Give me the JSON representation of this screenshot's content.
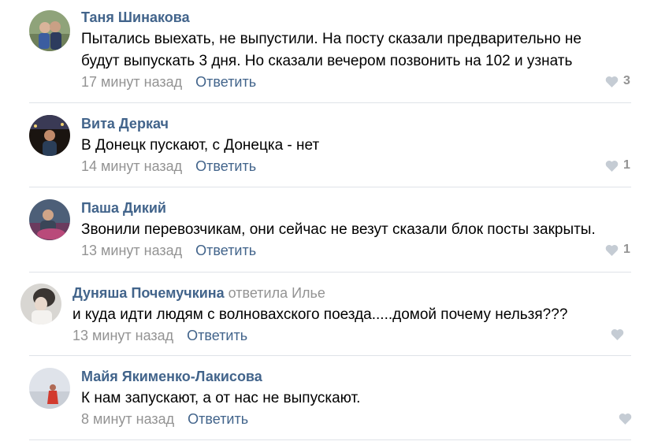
{
  "comments": [
    {
      "author": "Таня Шинакова",
      "reply_to": "",
      "text_lines": [
        "Пытались выехать, не выпустили. На посту сказали предварительно не",
        "будут выпускать 3 дня. Но сказали вечером позвонить на 102 и узнать"
      ],
      "time": "17 минут назад",
      "reply_label": "Ответить",
      "likes": "3"
    },
    {
      "author": "Вита Деркач",
      "reply_to": "",
      "text_lines": [
        "В Донецк пускают, с Донецка - нет"
      ],
      "time": "14 минут назад",
      "reply_label": "Ответить",
      "likes": "1"
    },
    {
      "author": "Паша Дикий",
      "reply_to": "",
      "text_lines": [
        "Звонили перевозчикам, они сейчас не везут сказали блок посты закрыты."
      ],
      "time": "13 минут назад",
      "reply_label": "Ответить",
      "likes": "1"
    },
    {
      "author": "Дуняша Почемучкина",
      "reply_to": "ответила Илье",
      "text_lines": [
        "и куда идти людям с волновахского поезда.....домой почему нельзя???"
      ],
      "time": "13 минут назад",
      "reply_label": "Ответить",
      "likes": ""
    },
    {
      "author": "Майя Якименко-Лакисова",
      "reply_to": "",
      "text_lines": [
        "К нам запускают, а от нас не выпускают."
      ],
      "time": "8 минут назад",
      "reply_label": "Ответить",
      "likes": ""
    }
  ],
  "colors": {
    "link": "#42648b",
    "muted": "#939393",
    "divider": "#dfe3e8",
    "heart": "#c5ccd4"
  }
}
